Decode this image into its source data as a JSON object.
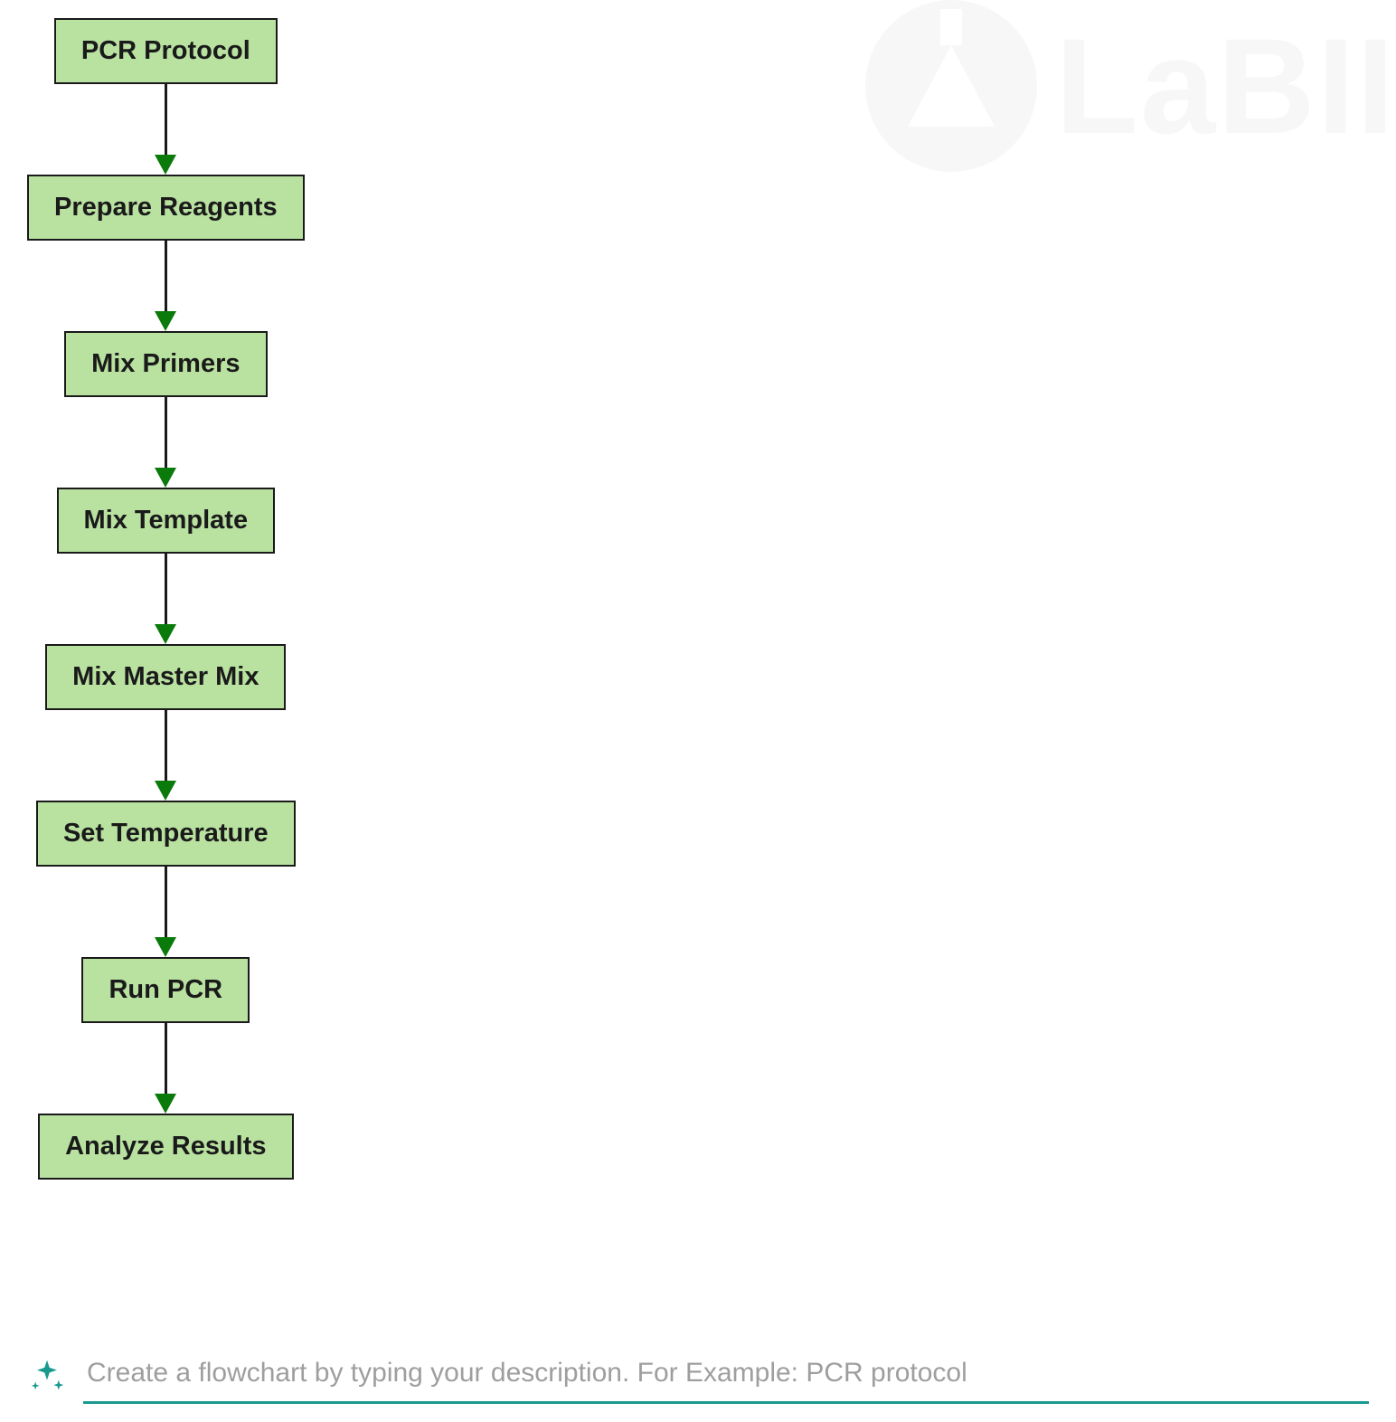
{
  "watermark": {
    "brand": "LaBII"
  },
  "flowchart": {
    "nodes": [
      {
        "label": "PCR Protocol"
      },
      {
        "label": "Prepare Reagents"
      },
      {
        "label": "Mix Primers"
      },
      {
        "label": "Mix Template"
      },
      {
        "label": "Mix Master Mix"
      },
      {
        "label": "Set Temperature"
      },
      {
        "label": "Run PCR"
      },
      {
        "label": "Analyze Results"
      }
    ]
  },
  "input": {
    "placeholder": "Create a flowchart by typing your description. For Example: PCR protocol",
    "value": ""
  },
  "chart_data": {
    "type": "flowchart",
    "direction": "top-to-bottom",
    "nodes": [
      "PCR Protocol",
      "Prepare Reagents",
      "Mix Primers",
      "Mix Template",
      "Mix Master Mix",
      "Set Temperature",
      "Run PCR",
      "Analyze Results"
    ],
    "edges": [
      [
        "PCR Protocol",
        "Prepare Reagents"
      ],
      [
        "Prepare Reagents",
        "Mix Primers"
      ],
      [
        "Mix Primers",
        "Mix Template"
      ],
      [
        "Mix Template",
        "Mix Master Mix"
      ],
      [
        "Mix Master Mix",
        "Set Temperature"
      ],
      [
        "Set Temperature",
        "Run PCR"
      ],
      [
        "Run PCR",
        "Analyze Results"
      ]
    ],
    "node_style": {
      "fill": "#b9e2a1",
      "stroke": "#1a1a1a"
    },
    "arrow_style": {
      "line": "#1a1a1a",
      "head": "#0a7a0a"
    }
  }
}
